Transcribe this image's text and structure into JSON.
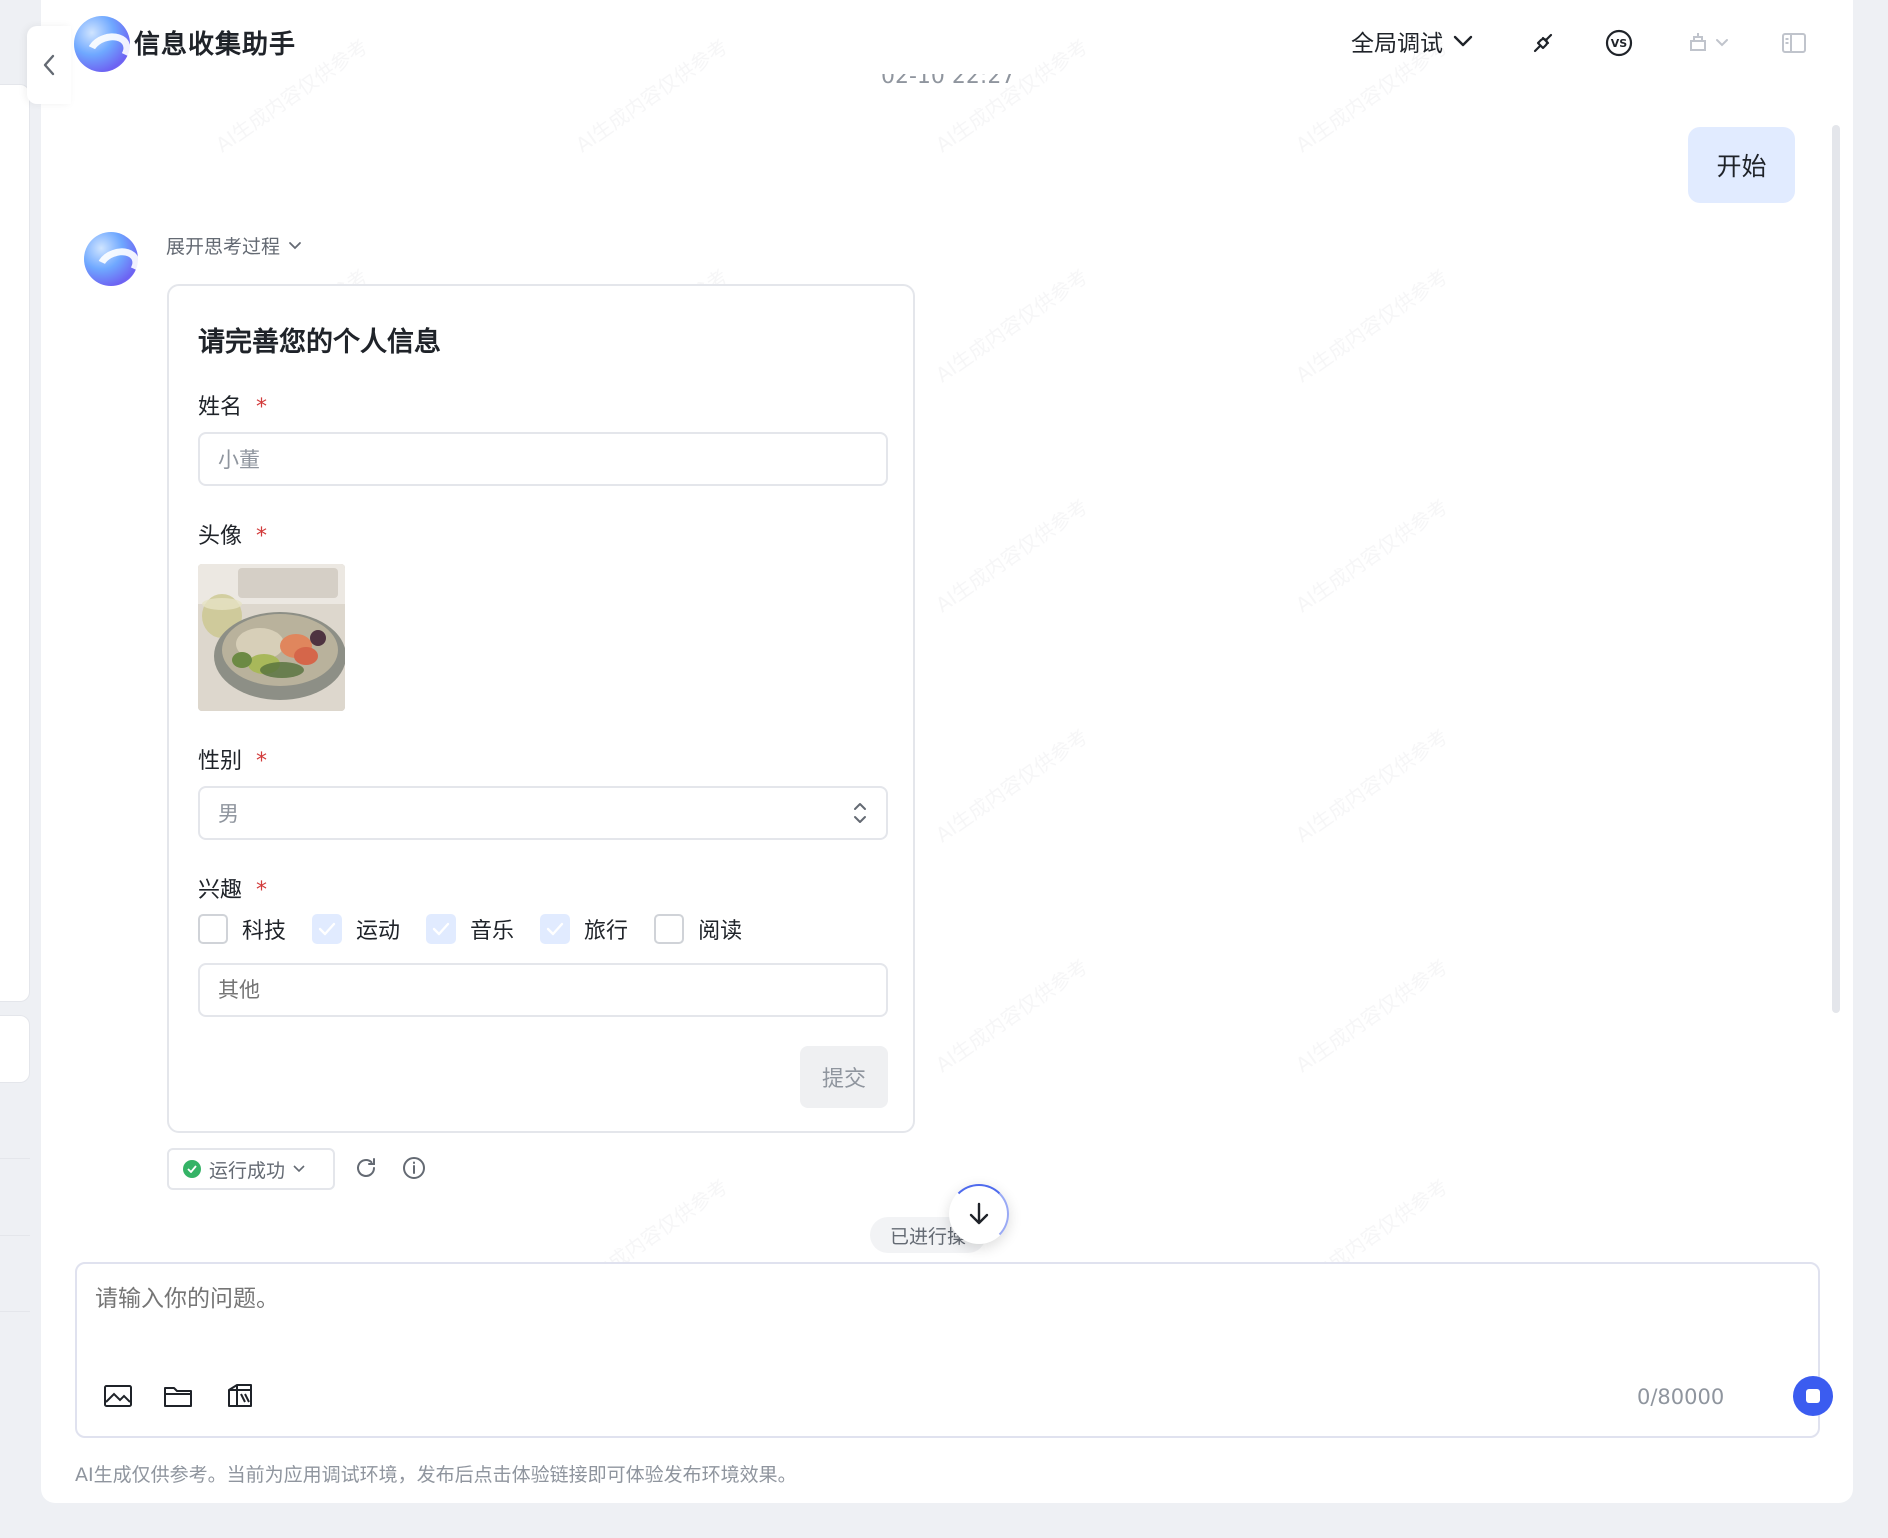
{
  "app": {
    "title": "信息收集助手",
    "debug_scope": "全局调试",
    "timestamp": "02-10 22:27"
  },
  "chat": {
    "user_message": "开始",
    "think_toggle": "展开思考过程"
  },
  "form": {
    "title": "请完善您的个人信息",
    "name_label": "姓名",
    "name_value": "小董",
    "avatar_label": "头像",
    "gender_label": "性别",
    "gender_value": "男",
    "interests_label": "兴趣",
    "required_mark": "*",
    "interests": [
      {
        "label": "科技",
        "checked": false
      },
      {
        "label": "运动",
        "checked": true
      },
      {
        "label": "音乐",
        "checked": true
      },
      {
        "label": "旅行",
        "checked": true
      },
      {
        "label": "阅读",
        "checked": false
      }
    ],
    "other_placeholder": "其他",
    "submit_label": "提交"
  },
  "status": {
    "run_status": "运行成功",
    "progress_text": "已进行操"
  },
  "composer": {
    "placeholder": "请输入你的问题。",
    "counter": "0/80000"
  },
  "footer": {
    "disclaimer": "AI生成仅供参考。当前为应用调试环境，发布后点击体验链接即可体验发布环境效果。"
  },
  "watermark_text": "AI生成内容仅供参考",
  "colors": {
    "accent": "#3b5cf0",
    "user_bubble": "#e1ebff",
    "required": "#d23b3b",
    "success": "#34b366"
  },
  "icons": [
    "chevron-left-icon",
    "chevron-down-icon",
    "plugin-icon",
    "vs-icon",
    "publish-icon",
    "sidebar-icon",
    "refresh-icon",
    "info-icon",
    "arrow-down-icon",
    "image-icon",
    "folder-icon",
    "knowledge-icon",
    "stop-icon"
  ]
}
